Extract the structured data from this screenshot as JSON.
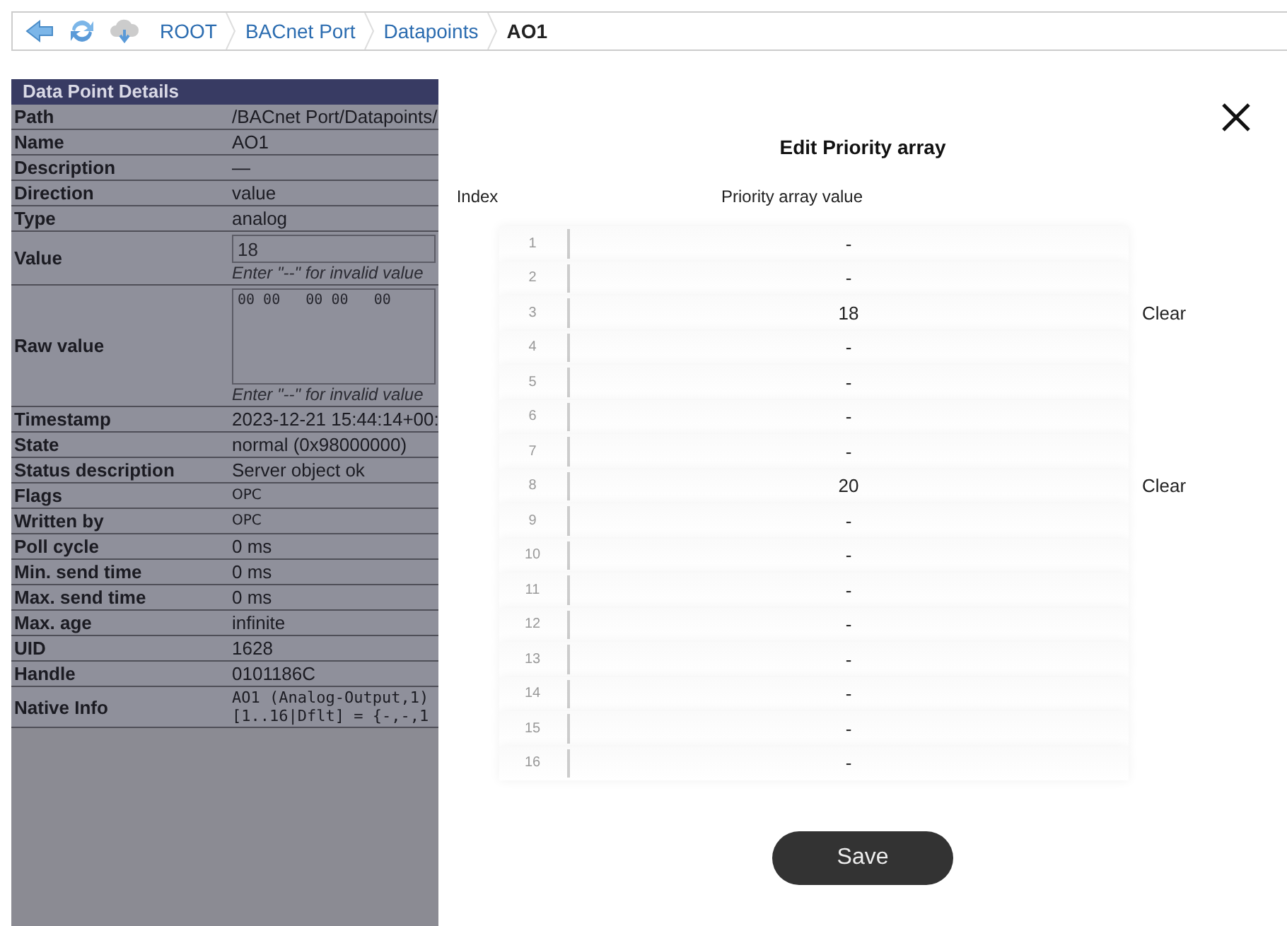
{
  "breadcrumb": {
    "items": [
      {
        "label": "ROOT",
        "current": false
      },
      {
        "label": "BACnet Port",
        "current": false
      },
      {
        "label": "Datapoints",
        "current": false
      },
      {
        "label": "AO1",
        "current": true
      }
    ]
  },
  "details": {
    "title": "Data Point Details",
    "rows": [
      {
        "label": "Path",
        "kind": "text",
        "value": "/BACnet Port/Datapoints/"
      },
      {
        "label": "Name",
        "kind": "text",
        "value": "AO1"
      },
      {
        "label": "Description",
        "kind": "text",
        "value": "—"
      },
      {
        "label": "Direction",
        "kind": "text",
        "value": "value"
      },
      {
        "label": "Type",
        "kind": "text",
        "value": "analog"
      },
      {
        "label": "Value",
        "kind": "input",
        "value": "18",
        "hint": "Enter \"--\" for invalid value"
      },
      {
        "label": "Raw value",
        "kind": "textarea",
        "value": "00 00   00 00   00",
        "hint": "Enter \"--\" for invalid value"
      },
      {
        "label": "Timestamp",
        "kind": "text",
        "value": "2023-12-21 15:44:14+00:"
      },
      {
        "label": "State",
        "kind": "text",
        "value": "normal (0x98000000)"
      },
      {
        "label": "Status description",
        "kind": "text",
        "value": "Server object ok"
      },
      {
        "label": "Flags",
        "kind": "small",
        "value": "OPC"
      },
      {
        "label": "Written by",
        "kind": "small",
        "value": "OPC"
      },
      {
        "label": "Poll cycle",
        "kind": "text",
        "value": "0 ms"
      },
      {
        "label": "Min. send time",
        "kind": "text",
        "value": "0 ms"
      },
      {
        "label": "Max. send time",
        "kind": "text",
        "value": "0 ms"
      },
      {
        "label": "Max. age",
        "kind": "text",
        "value": "infinite"
      },
      {
        "label": "UID",
        "kind": "text",
        "value": "1628"
      },
      {
        "label": "Handle",
        "kind": "text",
        "value": "0101186C"
      },
      {
        "label": "Native Info",
        "kind": "mono",
        "lines": [
          "AO1 (Analog-Output,1)",
          "[1..16|Dflt] = {-,-,1"
        ]
      }
    ]
  },
  "dialog": {
    "title": "Edit Priority array",
    "columns": [
      "Index",
      "Priority array value"
    ],
    "rows": [
      {
        "index": "1",
        "value": "-"
      },
      {
        "index": "2",
        "value": "-"
      },
      {
        "index": "3",
        "value": "18",
        "action": "Clear"
      },
      {
        "index": "4",
        "value": "-"
      },
      {
        "index": "5",
        "value": "-"
      },
      {
        "index": "6",
        "value": "-"
      },
      {
        "index": "7",
        "value": "-"
      },
      {
        "index": "8",
        "value": "20",
        "action": "Clear"
      },
      {
        "index": "9",
        "value": "-"
      },
      {
        "index": "10",
        "value": "-"
      },
      {
        "index": "11",
        "value": "-"
      },
      {
        "index": "12",
        "value": "-"
      },
      {
        "index": "13",
        "value": "-"
      },
      {
        "index": "14",
        "value": "-"
      },
      {
        "index": "15",
        "value": "-"
      },
      {
        "index": "16",
        "value": "-"
      }
    ],
    "save_button": "Save"
  }
}
